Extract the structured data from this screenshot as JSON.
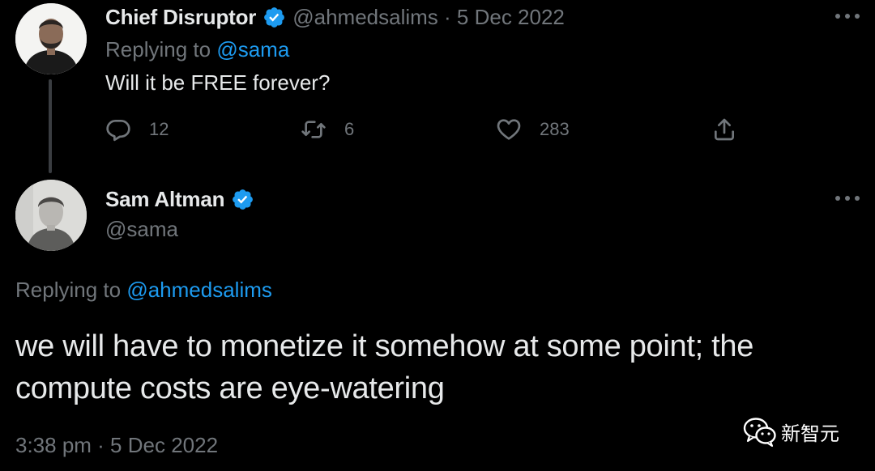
{
  "reply_tweet": {
    "display_name": "Chief Disruptor",
    "handle_date": "@ahmedsalims · 5 Dec 2022",
    "replying_prefix": "Replying to",
    "replying_handle": "@sama",
    "text": "Will it be FREE forever?",
    "actions": {
      "reply_count": "12",
      "retweet_count": "6",
      "like_count": "283"
    }
  },
  "main_tweet": {
    "display_name": "Sam Altman",
    "handle": "@sama",
    "replying_prefix": "Replying to",
    "replying_handle": "@ahmedsalims",
    "text": "we will have to monetize it somehow at some point; the compute costs are eye-watering",
    "timestamp": "3:38 pm · 5 Dec 2022"
  },
  "watermark": {
    "text": "新智元"
  },
  "icons": {
    "verified": "verified-badge-icon",
    "reply": "reply-icon",
    "retweet": "retweet-icon",
    "like": "heart-icon",
    "share": "share-icon",
    "more": "more-icon"
  },
  "colors": {
    "background": "#000000",
    "text_primary": "#e7e9ea",
    "text_secondary": "#71767b",
    "accent": "#1d9bf0",
    "thread_line": "#3a3d41"
  }
}
